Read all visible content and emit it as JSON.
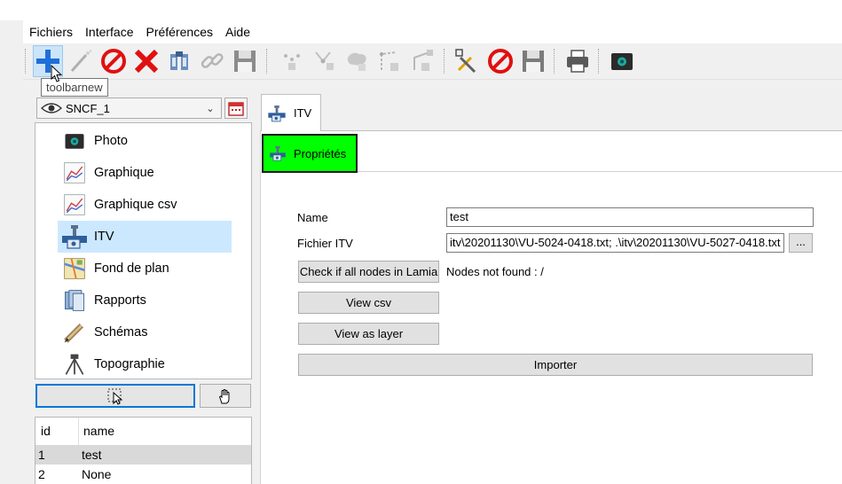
{
  "menu": [
    "Fichiers",
    "Interface",
    "Préférences",
    "Aide"
  ],
  "toolbar": {
    "tooltip": "toolbarnew",
    "icons": [
      "plus-icon",
      "magic-wand-icon",
      "forbidden-icon",
      "red-cross-icon",
      "database-icon",
      "link-icon",
      "save-icon",
      "add-node-icon",
      "add-vertex-icon",
      "add-polygon-icon",
      "add-line-icon",
      "add-tree-icon",
      "pick-tools-icon",
      "forbidden-icon",
      "save-icon",
      "printer-icon",
      "camera-icon"
    ]
  },
  "layer_select": {
    "value": "SNCF_1"
  },
  "object_list": {
    "items": [
      {
        "label": "Photo",
        "icon": "camera-icon"
      },
      {
        "label": "Graphique",
        "icon": "chart-icon"
      },
      {
        "label": "Graphique csv",
        "icon": "chart-csv-icon"
      },
      {
        "label": "ITV",
        "icon": "itv-camera-pipe-icon"
      },
      {
        "label": "Fond de plan",
        "icon": "map-icon"
      },
      {
        "label": "Rapports",
        "icon": "reports-icon"
      },
      {
        "label": "Schémas",
        "icon": "schema-pen-icon"
      },
      {
        "label": "Topographie",
        "icon": "tripod-icon"
      }
    ],
    "selected": "ITV"
  },
  "table": {
    "columns": [
      "id",
      "name"
    ],
    "rows": [
      {
        "id": "1",
        "name": "test"
      },
      {
        "id": "2",
        "name": "None"
      }
    ]
  },
  "main_tab": {
    "label": "ITV"
  },
  "sub_tab": {
    "label": "Propriétés"
  },
  "form": {
    "name_label": "Name",
    "name_value": "test",
    "file_label": "Fichier ITV",
    "file_value": "itv\\20201130\\VU-5024-0418.txt; .\\itv\\20201130\\VU-5027-0418.txt",
    "browse_label": "...",
    "check_button": "Check if all nodes in Lamia",
    "nodes_status": "Nodes not found : /",
    "view_csv_button": "View csv",
    "view_layer_button": "View as layer",
    "import_button": "Importer"
  },
  "colors": {
    "accent": "#0078d7",
    "selection": "#cce8ff",
    "subtab_bg": "#00ff00"
  }
}
